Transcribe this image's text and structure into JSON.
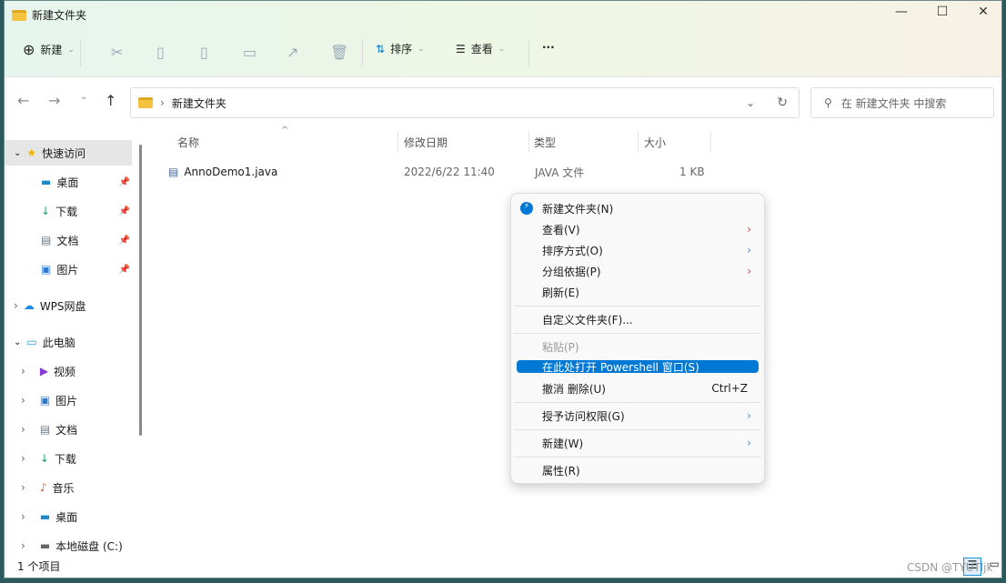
{
  "window": {
    "title": "新建文件夹",
    "minimize": "—",
    "maximize": "☐",
    "close": "✕"
  },
  "toolbar": {
    "new": "新建",
    "sort": "排序",
    "view": "查看",
    "more": "···"
  },
  "address": {
    "path": "新建文件夹",
    "search_placeholder": "在 新建文件夹 中搜索"
  },
  "sidebar": {
    "items": [
      {
        "label": "快速访问",
        "icon": "star-icon"
      },
      {
        "label": "桌面",
        "icon": "desktop-icon"
      },
      {
        "label": "下载",
        "icon": "download-icon"
      },
      {
        "label": "文档",
        "icon": "document-icon"
      },
      {
        "label": "图片",
        "icon": "pictures-icon"
      },
      {
        "label": "WPS网盘",
        "icon": "cloud-icon"
      },
      {
        "label": "此电脑",
        "icon": "pc-icon"
      },
      {
        "label": "视频",
        "icon": "video-icon"
      },
      {
        "label": "图片",
        "icon": "pictures-icon"
      },
      {
        "label": "文档",
        "icon": "document-icon"
      },
      {
        "label": "下载",
        "icon": "download-icon"
      },
      {
        "label": "音乐",
        "icon": "music-icon"
      },
      {
        "label": "桌面",
        "icon": "desktop-icon"
      },
      {
        "label": "本地磁盘 (C:)",
        "icon": "drive-icon"
      }
    ]
  },
  "columns": [
    "名称",
    "修改日期",
    "类型",
    "大小"
  ],
  "files": [
    {
      "name": "AnnoDemo1.java",
      "modified": "2022/6/22 11:40",
      "type": "JAVA 文件",
      "size": "1 KB"
    }
  ],
  "context_menu": [
    "新建文件夹(N)",
    "查看(V)",
    "排序方式(O)",
    "分组依据(P)",
    "刷新(E)",
    "自定义文件夹(F)...",
    "粘贴(P)",
    "在此处打开 Powershell 窗口(S)",
    "撤消 删除(U)",
    "授予访问权限(G)",
    "新建(W)",
    "属性(R)"
  ],
  "shortcut_undo": "Ctrl+Z",
  "status": "1 个项目",
  "watermark": "CSDN @TYUTljk",
  "colors": {
    "accent": "#0078d4"
  }
}
